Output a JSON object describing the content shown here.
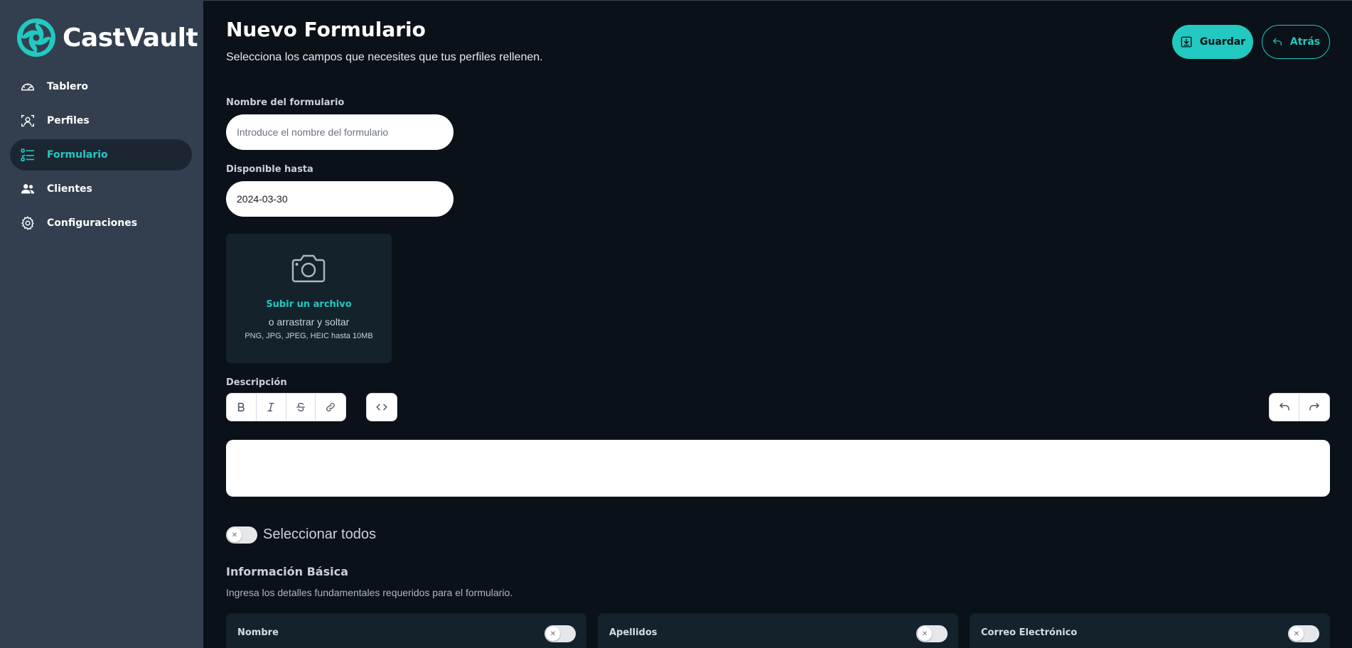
{
  "app": {
    "name": "CastVault",
    "accent": "#22c9c0"
  },
  "sidebar": {
    "items": [
      {
        "label": "Tablero",
        "icon": "dashboard-gauge-icon",
        "active": false
      },
      {
        "label": "Perfiles",
        "icon": "profile-id-icon",
        "active": false
      },
      {
        "label": "Formulario",
        "icon": "form-list-icon",
        "active": true
      },
      {
        "label": "Clientes",
        "icon": "clients-users-icon",
        "active": false
      },
      {
        "label": "Configuraciones",
        "icon": "gear-icon",
        "active": false
      }
    ]
  },
  "header": {
    "title": "Nuevo Formulario",
    "subtitle": "Selecciona los campos que necesites que tus perfiles rellenen.",
    "save_label": "Guardar",
    "back_label": "Atrás"
  },
  "form": {
    "name_label": "Nombre del formulario",
    "name_placeholder": "Introduce el nombre del formulario",
    "name_value": "",
    "date_label": "Disponible hasta",
    "date_value": "2024-03-30",
    "upload": {
      "link": "Subir un archivo",
      "drag": "o arrastrar y soltar",
      "types": "PNG, JPG, JPEG, HEIC hasta 10MB"
    },
    "description_label": "Descripción",
    "description_value": ""
  },
  "select_all": {
    "label": "Seleccionar todos",
    "checked": false
  },
  "section": {
    "title": "Información Básica",
    "description": "Ingresa los detalles fundamentales requeridos para el formulario.",
    "fields": [
      {
        "label": "Nombre",
        "enabled": false
      },
      {
        "label": "Apellidos",
        "enabled": false
      },
      {
        "label": "Correo Electrónico",
        "enabled": false
      }
    ]
  }
}
